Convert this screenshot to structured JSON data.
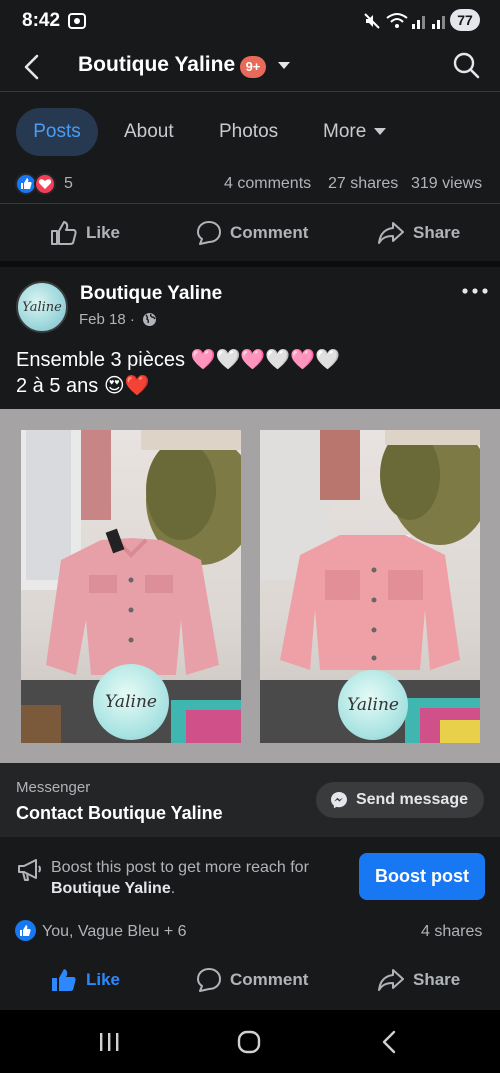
{
  "status_bar": {
    "time": "8:42",
    "battery": "77"
  },
  "header": {
    "title": "Boutique Yaline",
    "badge": "9+"
  },
  "tabs": [
    {
      "label": "Posts",
      "active": true
    },
    {
      "label": "About"
    },
    {
      "label": "Photos"
    },
    {
      "label": "More"
    }
  ],
  "prev_post": {
    "reaction_count": "5",
    "comments": "4 comments",
    "shares": "27 shares",
    "views": "319 views",
    "actions": {
      "like": "Like",
      "comment": "Comment",
      "share": "Share"
    }
  },
  "post": {
    "author": "Boutique Yaline",
    "date": "Feb 18 ·",
    "text_line1": "Ensemble 3 pièces 🩷🤍🩷🤍🩷🤍",
    "text_line2": "2 à 5 ans 😍❤️",
    "logo_text": "Yaline",
    "messenger_label": "Messenger",
    "contact_label": "Contact Boutique Yaline",
    "send_message": "Send message",
    "boost_line1": "Boost this post to get more reach for",
    "boost_page": "Boutique Yaline",
    "boost_period": ".",
    "boost_button": "Boost post",
    "reactions_text": "You, Vague Bleu + 6",
    "shares": "4 shares",
    "actions": {
      "like": "Like",
      "comment": "Comment",
      "share": "Share"
    }
  },
  "colors": {
    "accent": "#1877f2",
    "background": "#18191a",
    "like_active": "#2d88ff"
  }
}
